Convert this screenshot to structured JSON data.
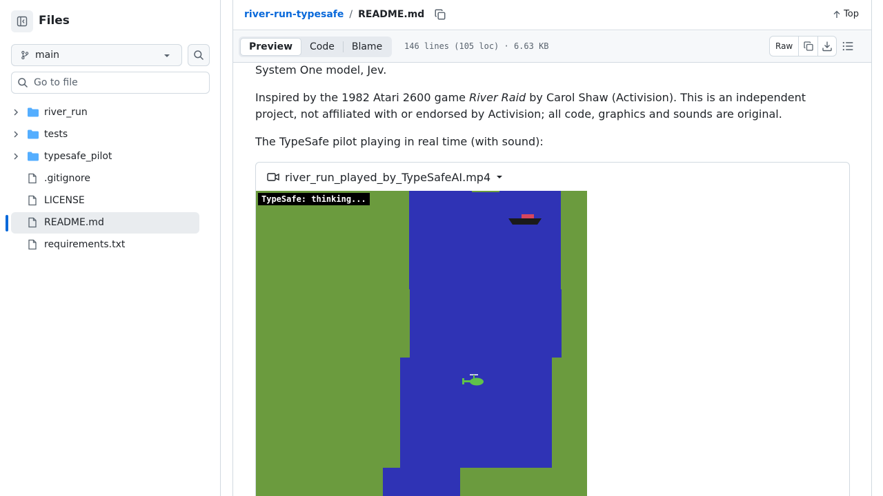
{
  "sidebar": {
    "title": "Files",
    "branch": "main",
    "goto_placeholder": "Go to file",
    "items": [
      {
        "label": "river_run",
        "type": "folder"
      },
      {
        "label": "tests",
        "type": "folder"
      },
      {
        "label": "typesafe_pilot",
        "type": "folder"
      },
      {
        "label": ".gitignore",
        "type": "file"
      },
      {
        "label": "LICENSE",
        "type": "file"
      },
      {
        "label": "README.md",
        "type": "file",
        "selected": true
      },
      {
        "label": "requirements.txt",
        "type": "file"
      }
    ]
  },
  "header": {
    "repo": "river-run-typesafe",
    "separator": "/",
    "file": "README.md",
    "top_label": "Top"
  },
  "toolbar": {
    "tabs": [
      "Preview",
      "Code",
      "Blame"
    ],
    "active_tab": "Preview",
    "file_info": "146 lines (105 loc) · 6.63 KB",
    "raw_label": "Raw"
  },
  "content": {
    "p1": "System One model, Jev.",
    "p2_before": "Inspired by the 1982 Atari 2600 game ",
    "p2_em": "River Raid",
    "p2_after": " by Carol Shaw (Activision). This is an independent project, not affiliated with or endorsed by Activision; all code, graphics and sounds are original.",
    "p3": "The TypeSafe pilot playing in real time (with sound):",
    "video": {
      "filename": "river_run_played_by_TypeSafeAI.mp4",
      "hud_text": "TypeSafe: thinking..."
    }
  },
  "colors": {
    "accent": "#0969da",
    "grass": "#6b9b3e",
    "river": "#2f33b5",
    "folder": "#54aeff"
  }
}
